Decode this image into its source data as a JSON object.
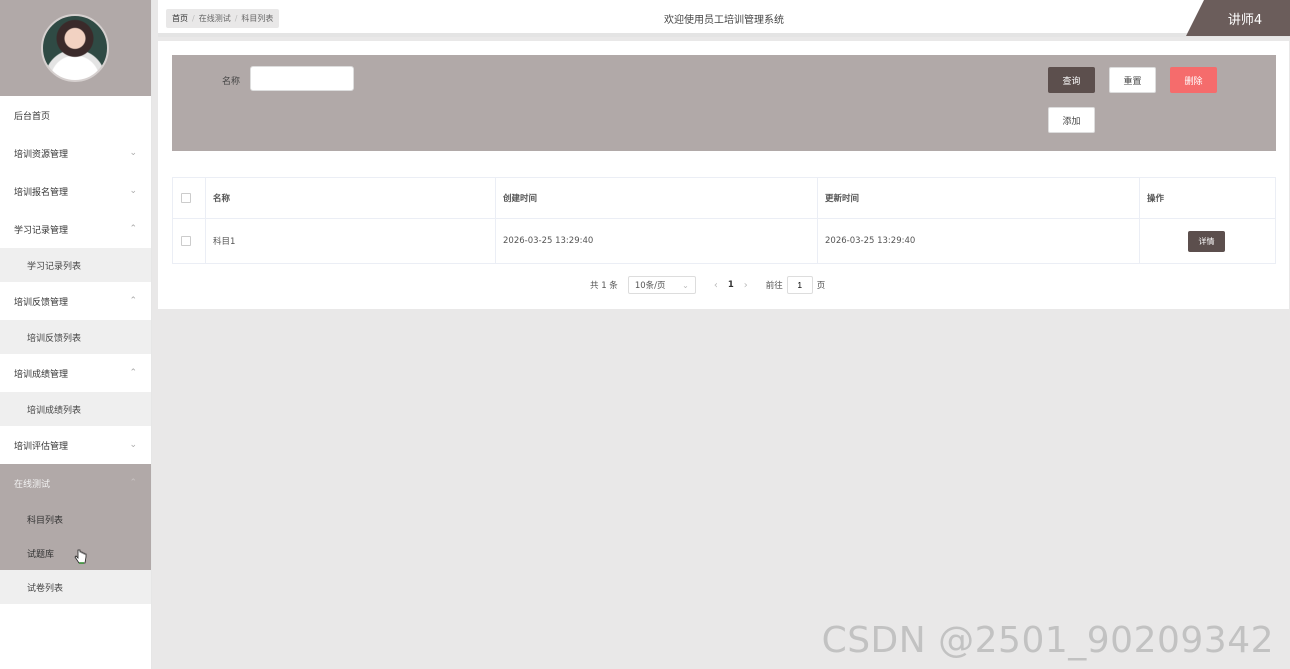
{
  "sidebar": {
    "items": [
      {
        "label": "后台首页",
        "chevron": ""
      },
      {
        "label": "培训资源管理",
        "chevron": "⌄"
      },
      {
        "label": "培训报名管理",
        "chevron": "⌄"
      },
      {
        "label": "学习记录管理",
        "chevron": "⌃"
      },
      {
        "label": "学习记录列表"
      },
      {
        "label": "培训反馈管理",
        "chevron": "⌃"
      },
      {
        "label": "培训反馈列表"
      },
      {
        "label": "培训成绩管理",
        "chevron": "⌃"
      },
      {
        "label": "培训成绩列表"
      },
      {
        "label": "培训评估管理",
        "chevron": "⌄"
      },
      {
        "label": "在线测试",
        "chevron": "⌃"
      },
      {
        "label": "科目列表"
      },
      {
        "label": "试题库"
      },
      {
        "label": "试卷列表"
      }
    ]
  },
  "header": {
    "breadcrumb": {
      "home": "首页",
      "separator": "/",
      "level1": "在线测试",
      "level2": "科目列表"
    },
    "title": "欢迎使用员工培训管理系统",
    "user": "讲师4"
  },
  "search": {
    "name_label": "名称",
    "name_value": "",
    "query_label": "查询",
    "reset_label": "重置",
    "delete_label": "删除",
    "add_label": "添加"
  },
  "table": {
    "columns": [
      "名称",
      "创建时间",
      "更新时间",
      "操作"
    ],
    "rows": [
      {
        "name": "科目1",
        "created": "2026-03-25 13:29:40",
        "updated": "2026-03-25 13:29:40",
        "action": "详情"
      }
    ]
  },
  "pagination": {
    "total": "共 1 条",
    "page_size": "10条/页",
    "prev": "‹",
    "current": "1",
    "next": "›",
    "goto_label": "前往",
    "goto_value": "1",
    "page_unit": "页"
  },
  "watermark": "CSDN @2501_90209342",
  "colors": {
    "accent": "#b1a9a8",
    "dark_button": "#5c4f4d",
    "danger": "#f56c6c",
    "badge": "#6b5d5b"
  }
}
